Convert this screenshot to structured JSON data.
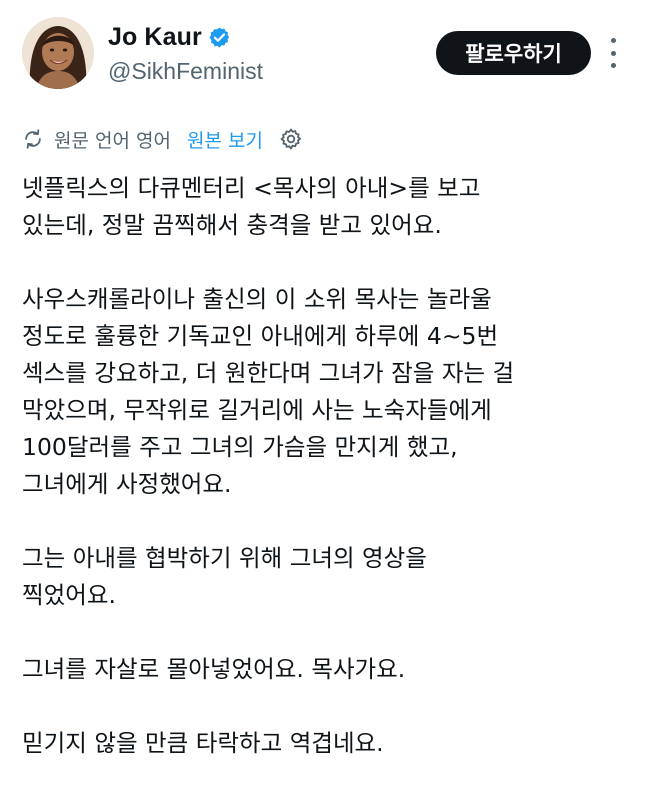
{
  "user": {
    "display_name": "Jo Kaur",
    "handle": "@SikhFeminist",
    "verified_color": "#1d9bf0"
  },
  "follow_button": {
    "label": "팔로우하기"
  },
  "icons": {
    "verified": "verified-badge-icon",
    "more": "more-options-icon",
    "translate": "translate-icon",
    "settings": "settings-gear-icon"
  },
  "translation": {
    "info": "원문 언어 영어",
    "show_original": "원본 보기"
  },
  "tweet": {
    "paragraphs": [
      [
        "넷플릭스의 다큐멘터리 <목사의 아내>를 보고",
        "있는데, 정말 끔찍해서 충격을 받고 있어요."
      ],
      [
        "사우스캐롤라이나 출신의 이 소위 목사는 놀라울",
        "정도로 훌륭한 기독교인 아내에게 하루에 4~5번",
        "섹스를 강요하고, 더 원한다며 그녀가 잠을 자는 걸",
        "막았으며, 무작위로 길거리에 사는 노숙자들에게",
        "100달러를 주고 그녀의 가슴을 만지게 했고,",
        "그녀에게 사정했어요."
      ],
      [
        "그는 아내를 협박하기 위해 그녀의 영상을",
        "찍었어요."
      ],
      [
        "그녀를 자살로 몰아넣었어요. 목사가요."
      ],
      [
        "믿기지 않을 만큼 타락하고 역겹네요."
      ]
    ]
  },
  "colors": {
    "text_primary": "#0f1419",
    "text_secondary": "#536471",
    "link": "#1d9bf0",
    "button_bg": "#0f1419",
    "button_text": "#ffffff"
  }
}
